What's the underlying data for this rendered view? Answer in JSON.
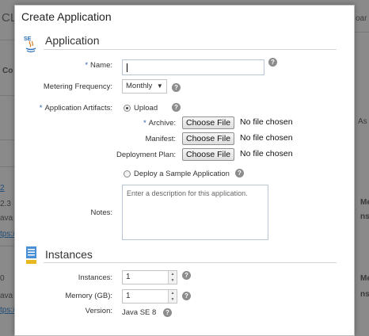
{
  "background": {
    "header_fragment": "CL",
    "column_fragment": "Co",
    "right_fragment_top": "oar",
    "right_fragment_as": "As",
    "row1_link": "2",
    "row1_version": "2.3",
    "row1_java": "ava S",
    "row1_url": "tps:/",
    "row1_right_a": "Me",
    "row1_right_b": "nst",
    "row2_first": "0",
    "row2_java": "ava S",
    "row2_url": "tps:/",
    "row2_right_a": "Me",
    "row2_right_b": "nst"
  },
  "dialog": {
    "title": "Create Application",
    "application_section": {
      "title": "Application",
      "icon": "java-se-icon",
      "name": {
        "label": "Name:",
        "required": "*",
        "value": ""
      },
      "metering": {
        "label": "Metering Frequency:",
        "selected": "Monthly",
        "arrow": "▼"
      },
      "artifacts": {
        "label": "Application Artifacts:",
        "required": "*",
        "upload_label": "Upload"
      },
      "archive": {
        "label": "Archive:",
        "required": "*",
        "button": "Choose File",
        "status": "No file chosen"
      },
      "manifest": {
        "label": "Manifest:",
        "button": "Choose File",
        "status": "No file chosen"
      },
      "deployment_plan": {
        "label": "Deployment Plan:",
        "button": "Choose File",
        "status": "No file chosen"
      },
      "sample": {
        "label": "Deploy a Sample Application"
      },
      "notes": {
        "label": "Notes:",
        "placeholder": "Enter a description for this application."
      }
    },
    "instances_section": {
      "title": "Instances",
      "icon": "instances-icon",
      "instances": {
        "label": "Instances:",
        "value": "1"
      },
      "memory": {
        "label": "Memory (GB):",
        "value": "1"
      },
      "version": {
        "label": "Version:",
        "value": "Java SE 8"
      }
    },
    "help_glyph": "?"
  }
}
